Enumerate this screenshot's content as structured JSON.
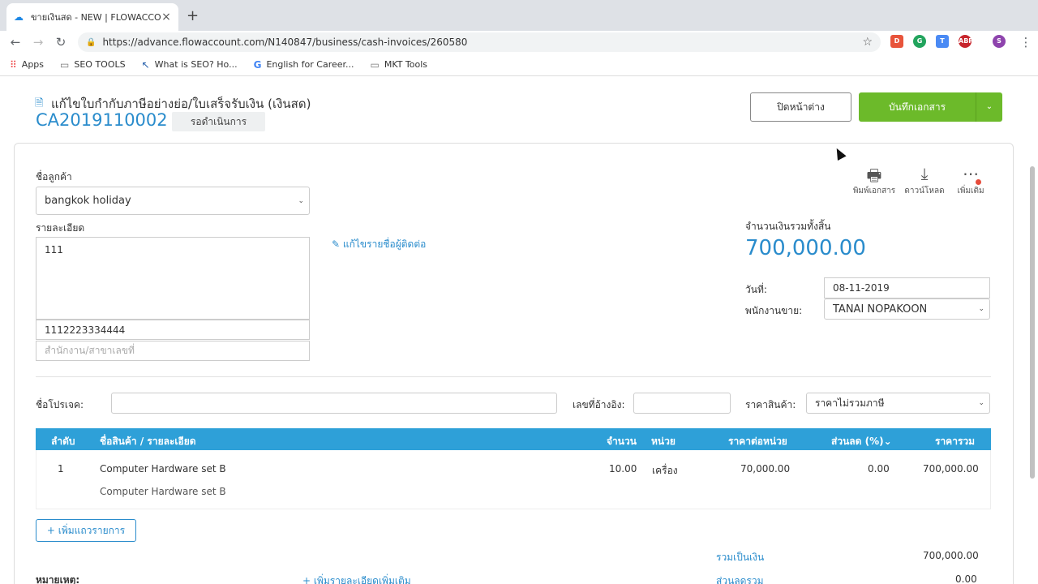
{
  "browser": {
    "tab_title": "ขายเงินสด - NEW | FLOWACCOU",
    "new_tab": "+",
    "url": "https://advance.flowaccount.com/N140847/business/cash-invoices/260580",
    "back": "←",
    "forward": "→",
    "reload": "↻",
    "star": "☆",
    "extensions": [
      {
        "label": "D",
        "color": "#e8543b",
        "icon": "pdf-extension-icon"
      },
      {
        "label": "G",
        "color": "#22a45d",
        "icon": "grammarly-icon"
      },
      {
        "label": "T",
        "color": "#4a8af4",
        "icon": "translate-icon"
      },
      {
        "label": "ABP",
        "color": "#c7252c",
        "icon": "adblock-icon"
      },
      {
        "label": "S",
        "color": "#8e44ad",
        "icon": "profile-avatar-icon"
      },
      {
        "label": "▲",
        "color": "#d9311f",
        "icon": "alert-extension-icon"
      }
    ],
    "menu": "⋮"
  },
  "bookmarks": [
    {
      "label": "Apps",
      "icon": "apps-grid-icon"
    },
    {
      "label": "SEO TOOLS",
      "icon": "folder-icon"
    },
    {
      "label": "What is SEO? Ho...",
      "icon": "cursor-favicon-icon"
    },
    {
      "label": "English for Career...",
      "icon": "google-icon"
    },
    {
      "label": "MKT Tools",
      "icon": "folder-icon"
    }
  ],
  "header": {
    "page_title": "แก้ไขใบกำกับภาษีอย่างย่อ/ใบเสร็จรับเงิน (เงินสด)",
    "doc_number": "CA2019110002",
    "status": "รอดำเนินการ",
    "close_label": "ปิดหน้าต่าง",
    "save_label": "บันทึกเอกสาร",
    "save_dropdown": "⌄"
  },
  "customer": {
    "label": "ชื่อลูกค้า",
    "value": "bangkok holiday",
    "details_label": "รายละเอียด",
    "address": "111",
    "tax_id": "1112223334444",
    "branch_placeholder": "สำนักงาน/สาขาเลขที่",
    "edit_contact_link": "แก้ไขรายชื่อผู้ติดต่อ"
  },
  "actions": [
    {
      "label": "พิมพ์เอกสาร",
      "glyph": "🖶",
      "icon": "print-icon"
    },
    {
      "label": "ดาวน์โหลด",
      "glyph": "⤓",
      "icon": "download-icon"
    },
    {
      "label": "เพิ่มเติม",
      "glyph": "⋯",
      "icon": "more-icon"
    }
  ],
  "summary": {
    "total_label": "จำนวนเงินรวมทั้งสิ้น",
    "total_amount": "700,000.00",
    "date_label": "วันที่:",
    "date_value": "08-11-2019",
    "salesperson_label": "พนักงานขาย:",
    "salesperson_value": "TANAI NOPAKOON"
  },
  "project": {
    "project_label": "ชื่อโปรเจค:",
    "project_value": "",
    "reference_label": "เลขที่อ้างอิง:",
    "reference_value": "",
    "price_label": "ราคาสินค้า:",
    "price_value": "ราคาไม่รวมภาษี"
  },
  "table": {
    "headers": {
      "no": "ลำดับ",
      "name": "ชื่อสินค้า / รายละเอียด",
      "qty": "จำนวน",
      "unit": "หน่วย",
      "unit_price": "ราคาต่อหน่วย",
      "discount": "ส่วนลด (%)",
      "total": "ราคารวม"
    },
    "rows": [
      {
        "no": "1",
        "name": "Computer Hardware set B",
        "description": "Computer Hardware set B",
        "qty": "10.00",
        "unit": "เครื่อง",
        "unit_price": "70,000.00",
        "discount": "0.00",
        "total": "700,000.00"
      }
    ],
    "add_row": "+ เพิ่มแถวรายการ"
  },
  "footer": {
    "note_label": "หมายเหตุ:",
    "add_detail_link": "+ เพิ่มรายละเอียดเพิ่มเติม",
    "subtotal_label": "รวมเป็นเงิน",
    "subtotal_value": "700,000.00",
    "discount_label": "ส่วนลดรวม",
    "discount_value": "0.00"
  },
  "colors": {
    "accent": "#2a8ccc",
    "save_green": "#6cba2a",
    "table_header": "#2ea0d8"
  }
}
